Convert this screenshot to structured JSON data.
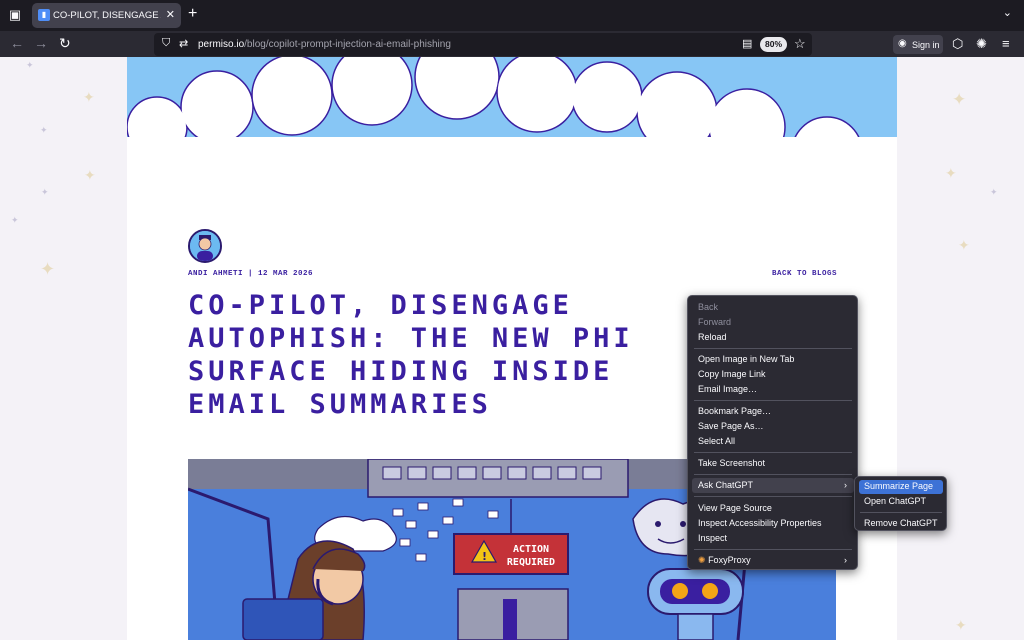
{
  "browser": {
    "tab_title": "CO-PILOT, DISENGAGE AUTOPHISH",
    "url_host": "permiso.io",
    "url_path": "/blog/copilot-prompt-injection-ai-email-phishing",
    "zoom": "80%",
    "sign_in": "Sign in"
  },
  "article": {
    "meta": "ANDI AHMETI | 12 MAR 2026",
    "back": "BACK TO BLOGS",
    "headline": [
      "CO-PILOT, DISENGAGE",
      "AUTOPHISH: THE NEW PHI",
      "SURFACE HIDING INSIDE",
      "EMAIL SUMMARIES"
    ],
    "hero": {
      "banner_line1": "ACTION",
      "banner_line2": "REQUIRED"
    }
  },
  "context_menu": {
    "back": "Back",
    "forward": "Forward",
    "reload": "Reload",
    "open_image": "Open Image in New Tab",
    "copy_image_link": "Copy Image Link",
    "email_image": "Email Image…",
    "bookmark": "Bookmark Page…",
    "save_as": "Save Page As…",
    "select_all": "Select All",
    "screenshot": "Take Screenshot",
    "ask_chatgpt": "Ask ChatGPT",
    "view_source": "View Page Source",
    "inspect_accessibility": "Inspect Accessibility Properties",
    "inspect": "Inspect",
    "foxyproxy": "FoxyProxy"
  },
  "submenu": {
    "summarize": "Summarize Page",
    "open": "Open ChatGPT",
    "remove": "Remove ChatGPT"
  },
  "colors": {
    "accent": "#3a1fa0",
    "sky": "#87c6f5",
    "highlight": "#3d72d6"
  },
  "icons": [
    "tab-list-icon",
    "close-icon",
    "plus-icon",
    "chevron-down-icon",
    "back-arrow-icon",
    "forward-arrow-icon",
    "reload-icon",
    "shield-icon",
    "permissions-icon",
    "reader-view-icon",
    "star-icon",
    "account-icon",
    "extensions-icon",
    "menu-icon"
  ]
}
